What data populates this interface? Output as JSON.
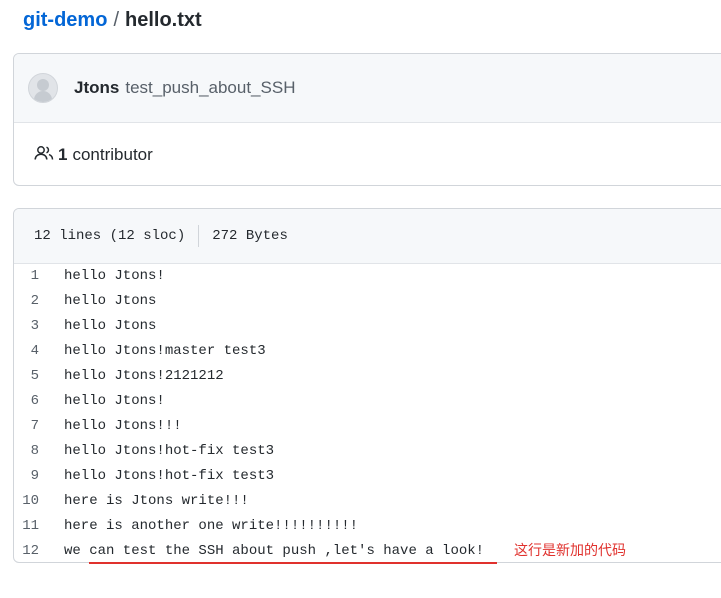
{
  "breadcrumb": {
    "repo": "git-demo",
    "separator": "/",
    "file": "hello.txt"
  },
  "commit": {
    "author": "Jtons",
    "message": "test_push_about_SSH"
  },
  "contributors": {
    "icon": "people-icon",
    "count": "1",
    "label": "contributor"
  },
  "file_info": {
    "lines": "12 lines (12 sloc)",
    "size": "272 Bytes"
  },
  "code_lines": [
    {
      "num": "1",
      "text": "hello Jtons!"
    },
    {
      "num": "2",
      "text": "hello Jtons"
    },
    {
      "num": "3",
      "text": "hello Jtons"
    },
    {
      "num": "4",
      "text": "hello Jtons!master test3"
    },
    {
      "num": "5",
      "text": "hello Jtons!2121212"
    },
    {
      "num": "6",
      "text": "hello Jtons!"
    },
    {
      "num": "7",
      "text": "hello Jtons!!!"
    },
    {
      "num": "8",
      "text": "hello Jtons!hot-fix test3"
    },
    {
      "num": "9",
      "text": "hello Jtons!hot-fix test3"
    },
    {
      "num": "10",
      "text": "here is Jtons write!!!"
    },
    {
      "num": "11",
      "text": "here is another one write!!!!!!!!!!"
    },
    {
      "num": "12",
      "text": "we can test the SSH about push ,let's have a look!"
    }
  ],
  "annotation": {
    "text": "这行是新加的代码",
    "color": "#e0312d"
  },
  "colors": {
    "link": "#0366d6",
    "header_bg": "#f6f8fa",
    "border": "#d1d5da"
  }
}
